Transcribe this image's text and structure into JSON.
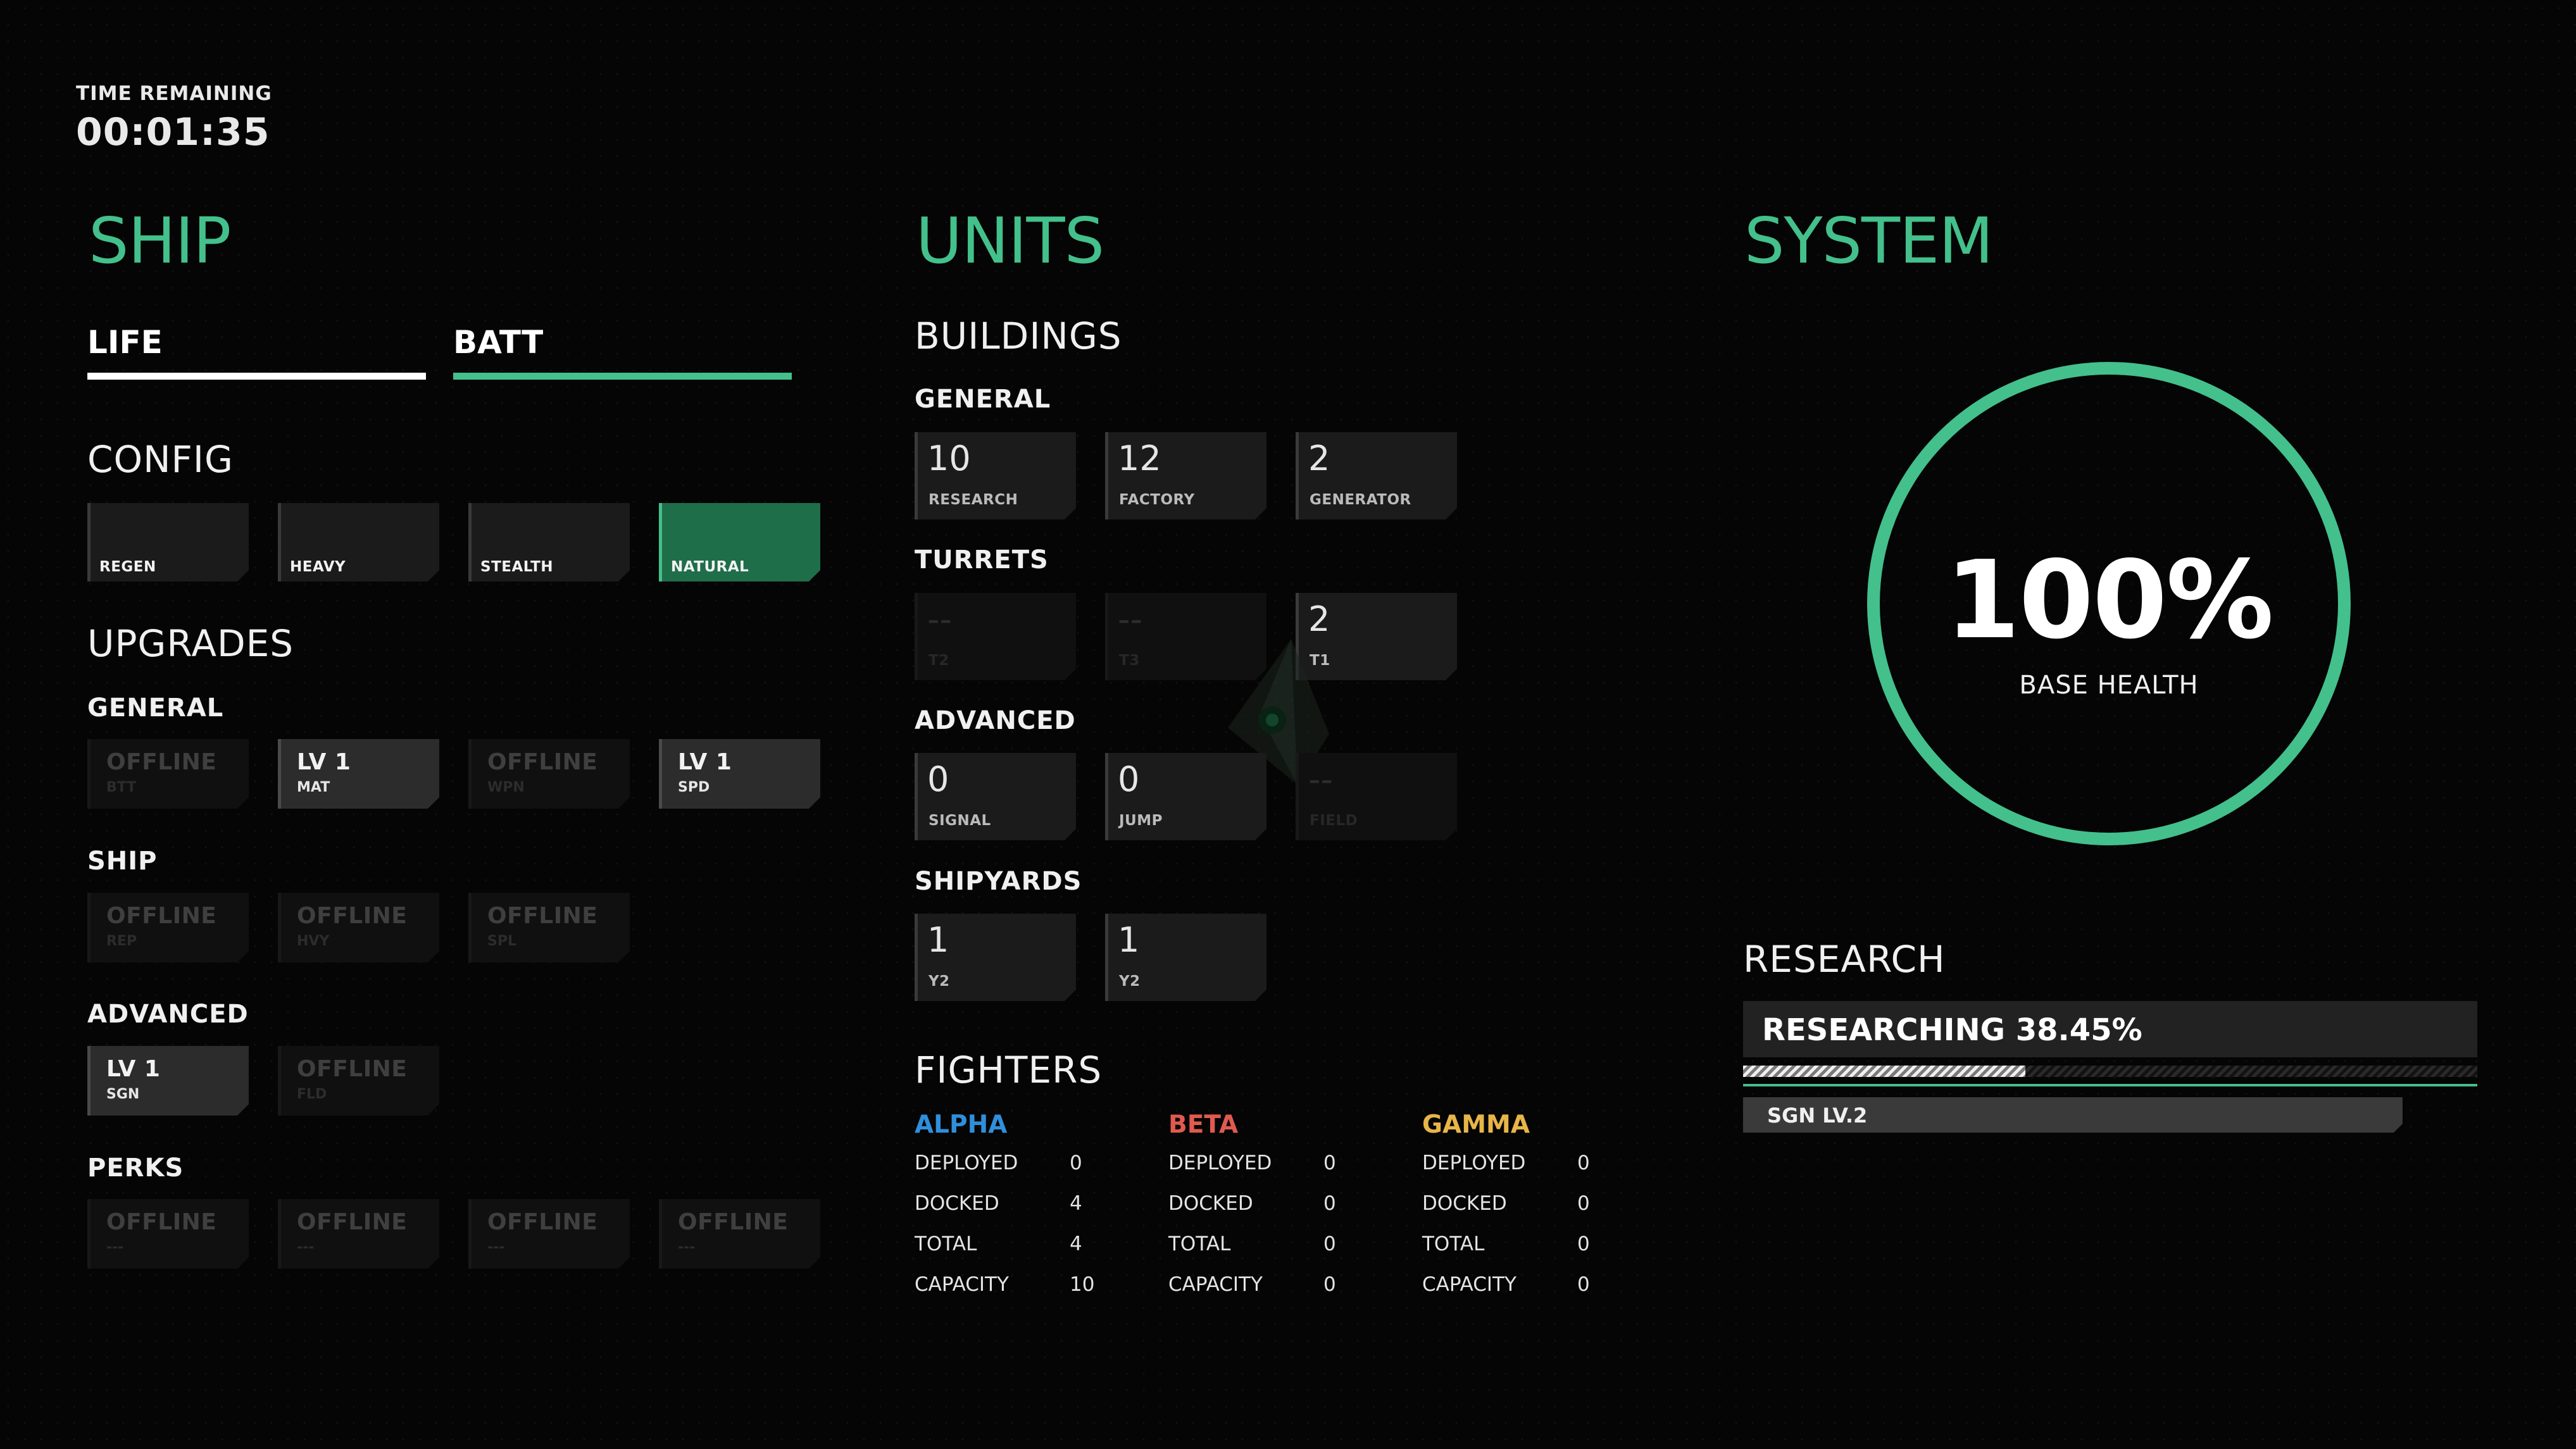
{
  "timer": {
    "label": "TIME REMAINING",
    "value": "00:01:35"
  },
  "ship": {
    "title": "SHIP",
    "tabs": [
      {
        "label": "LIFE",
        "state": "selected"
      },
      {
        "label": "BATT",
        "state": "accent"
      }
    ],
    "config": {
      "heading": "CONFIG",
      "options": [
        {
          "label": "REGEN",
          "selected": false
        },
        {
          "label": "HEAVY",
          "selected": false
        },
        {
          "label": "STEALTH",
          "selected": false
        },
        {
          "label": "NATURAL",
          "selected": true
        }
      ]
    },
    "upgrades": {
      "heading": "UPGRADES",
      "general": {
        "label": "GENERAL",
        "items": [
          {
            "main": "OFFLINE",
            "sub": "BTT"
          },
          {
            "main": "LV 1",
            "sub": "MAT"
          },
          {
            "main": "OFFLINE",
            "sub": "WPN"
          },
          {
            "main": "LV 1",
            "sub": "SPD"
          }
        ]
      },
      "ship": {
        "label": "SHIP",
        "items": [
          {
            "main": "OFFLINE",
            "sub": "REP"
          },
          {
            "main": "OFFLINE",
            "sub": "HVY"
          },
          {
            "main": "OFFLINE",
            "sub": "SPL"
          }
        ]
      },
      "advanced": {
        "label": "ADVANCED",
        "items": [
          {
            "main": "LV 1",
            "sub": "SGN"
          },
          {
            "main": "OFFLINE",
            "sub": "FLD"
          }
        ]
      },
      "perks": {
        "label": "PERKS",
        "items": [
          {
            "main": "OFFLINE",
            "sub": "---"
          },
          {
            "main": "OFFLINE",
            "sub": "---"
          },
          {
            "main": "OFFLINE",
            "sub": "---"
          },
          {
            "main": "OFFLINE",
            "sub": "---"
          }
        ]
      }
    }
  },
  "units": {
    "title": "UNITS",
    "buildings": {
      "heading": "BUILDINGS",
      "general": {
        "label": "GENERAL",
        "items": [
          {
            "value": "10",
            "label": "RESEARCH"
          },
          {
            "value": "12",
            "label": "FACTORY"
          },
          {
            "value": "2",
            "label": "GENERATOR"
          }
        ]
      },
      "turrets": {
        "label": "TURRETS",
        "items": [
          {
            "value": "--",
            "label": "T2"
          },
          {
            "value": "--",
            "label": "T3"
          },
          {
            "value": "2",
            "label": "T1"
          }
        ]
      },
      "advanced": {
        "label": "ADVANCED",
        "items": [
          {
            "value": "0",
            "label": "SIGNAL"
          },
          {
            "value": "0",
            "label": "JUMP"
          },
          {
            "value": "--",
            "label": "FIELD"
          }
        ]
      },
      "shipyards": {
        "label": "SHIPYARDS",
        "items": [
          {
            "value": "1",
            "label": "Y2"
          },
          {
            "value": "1",
            "label": "Y2"
          }
        ]
      }
    },
    "fighters": {
      "heading": "FIGHTERS",
      "squads": [
        {
          "name": "ALPHA",
          "color": "#2f8fdb",
          "deployed": "0",
          "docked": "4",
          "total": "4",
          "capacity": "10"
        },
        {
          "name": "BETA",
          "color": "#e05a4f",
          "deployed": "0",
          "docked": "0",
          "total": "0",
          "capacity": "0"
        },
        {
          "name": "GAMMA",
          "color": "#e7b548",
          "deployed": "0",
          "docked": "0",
          "total": "0",
          "capacity": "0"
        }
      ],
      "row_labels": {
        "deployed": "DEPLOYED",
        "docked": "DOCKED",
        "total": "TOTAL",
        "capacity": "CAPACITY"
      }
    }
  },
  "system": {
    "title": "SYSTEM",
    "base_health": {
      "value": "100%",
      "label": "BASE HEALTH",
      "fraction": 1.0
    },
    "research": {
      "heading": "RESEARCH",
      "status": "RESEARCHING 38.45%",
      "progress": 0.3845,
      "queue": [
        "SGN LV.2"
      ]
    }
  },
  "colors": {
    "accent": "#43c08b",
    "selected_tile": "#1f6e4a",
    "background": "#050505"
  }
}
